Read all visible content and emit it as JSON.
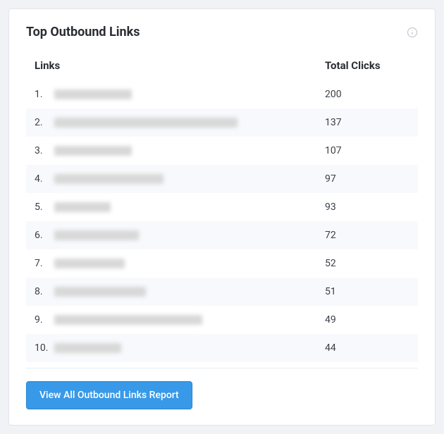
{
  "card": {
    "title": "Top Outbound Links"
  },
  "table": {
    "header": {
      "links": "Links",
      "clicks": "Total Clicks"
    },
    "rows": [
      {
        "num": "1.",
        "clicks": "200",
        "blur_width": 110
      },
      {
        "num": "2.",
        "clicks": "137",
        "blur_width": 260
      },
      {
        "num": "3.",
        "clicks": "107",
        "blur_width": 110
      },
      {
        "num": "4.",
        "clicks": "97",
        "blur_width": 155
      },
      {
        "num": "5.",
        "clicks": "93",
        "blur_width": 80
      },
      {
        "num": "6.",
        "clicks": "72",
        "blur_width": 120
      },
      {
        "num": "7.",
        "clicks": "52",
        "blur_width": 100
      },
      {
        "num": "8.",
        "clicks": "51",
        "blur_width": 130
      },
      {
        "num": "9.",
        "clicks": "49",
        "blur_width": 210
      },
      {
        "num": "10.",
        "clicks": "44",
        "blur_width": 95
      }
    ]
  },
  "footer": {
    "button_label": "View All Outbound Links Report"
  }
}
